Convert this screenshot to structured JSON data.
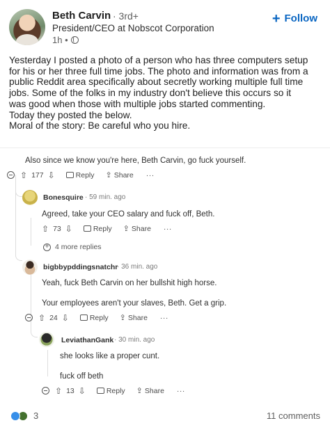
{
  "author": {
    "name": "Beth Carvin",
    "degree": "· 3rd+",
    "headline": "President/CEO at Nobscot Corporation",
    "timestamp": "1h •"
  },
  "follow_label": "Follow",
  "post_lines": [
    "Yesterday I posted a photo of a person who has three computers setup",
    "for his or her three full time jobs. The photo and information was from a",
    "public Reddit area specifically about secretly working multiple full time",
    "jobs. Some of the folks in my industry don't believe this occurs so it",
    "was good when those with multiple jobs started commenting.",
    "Today they posted the below.",
    "Moral of the story: Be careful who you hire."
  ],
  "reddit": {
    "top_comment": {
      "text": "Also since we know you're here, Beth Carvin, go fuck yourself.",
      "votes": "177",
      "reply": "Reply",
      "share": "Share",
      "more": "···"
    },
    "reply1": {
      "user": "Bonesquire",
      "time": "59 min. ago",
      "text": "Agreed, take your CEO salary and fuck off, Beth.",
      "votes": "73",
      "reply": "Reply",
      "share": "Share",
      "more": "···"
    },
    "more_replies": "4 more replies",
    "reply2": {
      "user": "bigbbypddingsnatchr",
      "time": "36 min. ago",
      "text1": "Yeah, fuck Beth Carvin on her bullshit high horse.",
      "text2": "Your employees aren't your slaves, Beth. Get a grip.",
      "votes": "24",
      "reply": "Reply",
      "share": "Share",
      "more": "···"
    },
    "reply3": {
      "user": "LeviathanGank",
      "time": "30 min. ago",
      "text1": "she looks like a proper cunt.",
      "text2": "fuck off beth",
      "votes": "13",
      "reply": "Reply",
      "share": "Share",
      "more": "···"
    }
  },
  "footer": {
    "reactions_count": "3",
    "comments": "11 comments"
  }
}
